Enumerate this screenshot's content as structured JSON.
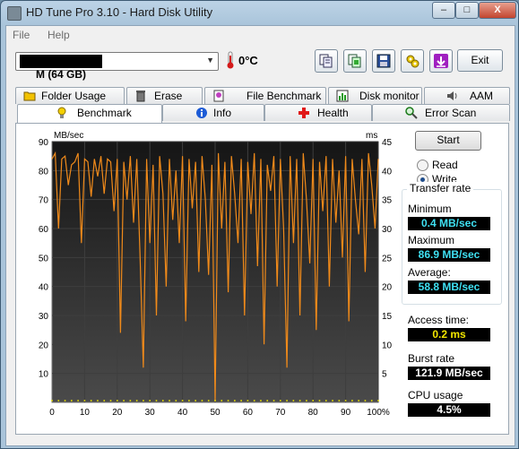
{
  "window": {
    "title": "HD Tune Pro 3.10 - Hard Disk Utility",
    "min_label": "–",
    "max_label": "□",
    "close_label": "X"
  },
  "menu": [
    "File",
    "Help"
  ],
  "toolbar": {
    "drive": "TS64GSSD25S-M (64 GB)",
    "temperature": "0°C",
    "exit_label": "Exit",
    "buttons": [
      "copy-info-icon",
      "copy-screenshot-icon",
      "save-icon",
      "options-icon",
      "download-icon"
    ]
  },
  "tabs_top": [
    {
      "label": "Folder Usage",
      "icon": "folder-icon"
    },
    {
      "label": "Erase",
      "icon": "trash-icon"
    },
    {
      "label": "File Benchmark",
      "icon": "file-benchmark-icon"
    },
    {
      "label": "Disk monitor",
      "icon": "monitor-icon"
    },
    {
      "label": "AAM",
      "icon": "speaker-icon"
    }
  ],
  "tabs_bottom": [
    {
      "label": "Benchmark",
      "icon": "bulb-icon",
      "active": true
    },
    {
      "label": "Info",
      "icon": "info-icon"
    },
    {
      "label": "Health",
      "icon": "health-cross-icon"
    },
    {
      "label": "Error Scan",
      "icon": "magnifier-icon"
    }
  ],
  "benchmark": {
    "start_label": "Start",
    "read_label": "Read",
    "write_label": "Write",
    "selected_mode": "Write",
    "transfer_rate_title": "Transfer rate",
    "minimum_label": "Minimum",
    "minimum_value": "0.4 MB/sec",
    "maximum_label": "Maximum",
    "maximum_value": "86.9 MB/sec",
    "average_label": "Average:",
    "average_value": "58.8 MB/sec",
    "access_label": "Access time:",
    "access_value": "0.2 ms",
    "burst_label": "Burst rate",
    "burst_value": "121.9 MB/sec",
    "cpu_label": "CPU usage",
    "cpu_value": "4.5%"
  },
  "colors": {
    "transfer_line": "#f08a1a",
    "access_dots": "#e8e000",
    "plot_bg_top": "#151515",
    "plot_bg_bottom": "#4a4a4a"
  },
  "chart_data": {
    "type": "line",
    "ylabel": "MB/sec",
    "y2label": "ms",
    "ylim": [
      0,
      90
    ],
    "y2lim": [
      0,
      45
    ],
    "xlim": [
      0,
      100
    ],
    "x_ticks": [
      "0",
      "10",
      "20",
      "30",
      "40",
      "50",
      "60",
      "70",
      "80",
      "90",
      "100%"
    ],
    "y_ticks": [
      "10",
      "20",
      "30",
      "40",
      "50",
      "60",
      "70",
      "80",
      "90"
    ],
    "y2_ticks": [
      "5",
      "10",
      "15",
      "20",
      "25",
      "30",
      "35",
      "40",
      "45"
    ],
    "grid": true,
    "series": [
      {
        "name": "Transfer rate",
        "x": [
          0,
          1,
          2,
          3,
          4,
          5,
          6,
          7,
          8,
          9,
          10,
          11,
          12,
          13,
          14,
          15,
          16,
          17,
          18,
          19,
          20,
          21,
          22,
          23,
          24,
          25,
          26,
          27,
          28,
          29,
          30,
          31,
          32,
          33,
          34,
          35,
          36,
          37,
          38,
          39,
          40,
          41,
          42,
          43,
          44,
          45,
          46,
          47,
          48,
          49,
          50,
          51,
          52,
          53,
          54,
          55,
          56,
          57,
          58,
          59,
          60,
          61,
          62,
          63,
          64,
          65,
          66,
          67,
          68,
          69,
          70,
          71,
          72,
          73,
          74,
          75,
          76,
          77,
          78,
          79,
          80,
          81,
          82,
          83,
          84,
          85,
          86,
          87,
          88,
          89,
          90,
          91,
          92,
          93,
          94,
          95,
          96,
          97,
          98,
          99,
          100
        ],
        "y": [
          84,
          86,
          60,
          84,
          85,
          75,
          82,
          83,
          86,
          55,
          84,
          83,
          71,
          84,
          78,
          85,
          72,
          84,
          83,
          66,
          84,
          24,
          83,
          70,
          85,
          62,
          84,
          50,
          12,
          84,
          55,
          82,
          30,
          85,
          72,
          40,
          84,
          63,
          80,
          55,
          85,
          28,
          84,
          67,
          83,
          45,
          85,
          70,
          44,
          82,
          0.4,
          86,
          60,
          83,
          38,
          85,
          72,
          55,
          84,
          30,
          83,
          65,
          86,
          47,
          84,
          20,
          82,
          73,
          85,
          40,
          84,
          60,
          12,
          85,
          55,
          84,
          30,
          86,
          70,
          48,
          84,
          25,
          83,
          66,
          85,
          40,
          84,
          62,
          80,
          50,
          85,
          28,
          84,
          70,
          58,
          84,
          45,
          86,
          75,
          60,
          84
        ]
      },
      {
        "name": "Access time",
        "type": "scatter",
        "unit": "ms",
        "value": 0.2
      }
    ]
  }
}
